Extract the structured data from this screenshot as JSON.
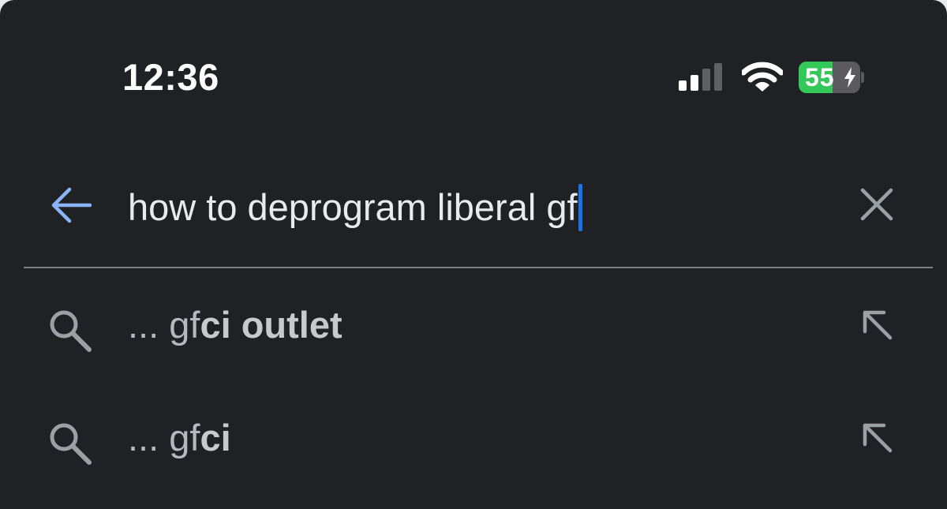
{
  "status_bar": {
    "time": "12:36",
    "signal_icon": "cellular-signal-icon",
    "wifi_icon": "wifi-icon",
    "battery_level": "55",
    "battery_fraction": 0.55,
    "battery_charging": true
  },
  "search": {
    "back_icon": "arrow-left-icon",
    "query": "how to deprogram liberal gf",
    "clear_icon": "close-icon"
  },
  "suggestions": [
    {
      "prefix": "... gf",
      "completion": "ci outlet",
      "icon": "search-icon",
      "action_icon": "arrow-up-left-icon"
    },
    {
      "prefix": "... gf",
      "completion": "ci",
      "icon": "search-icon",
      "action_icon": "arrow-up-left-icon"
    }
  ],
  "colors": {
    "background": "#202124",
    "accent_blue": "#1a73e8",
    "back_arrow": "#8ab4f8",
    "battery_green": "#34c759"
  }
}
